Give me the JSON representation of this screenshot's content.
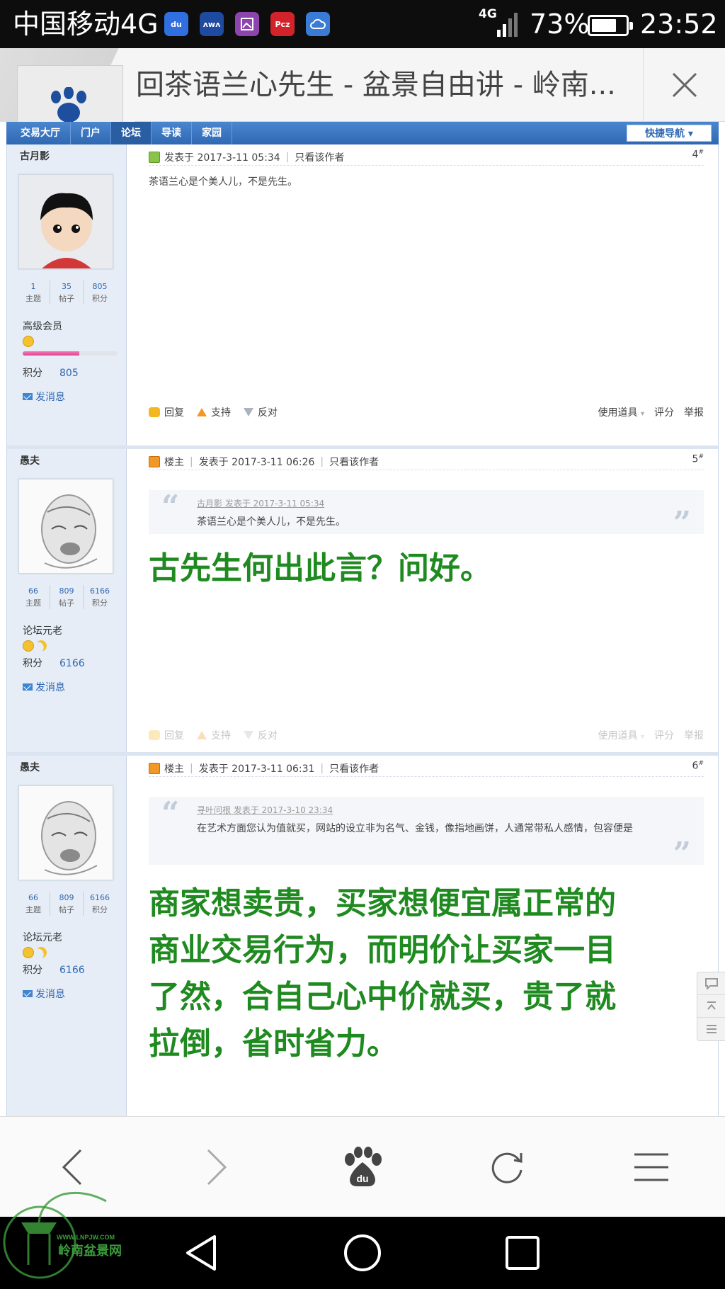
{
  "status_bar": {
    "carrier": "中国移动4G",
    "network": "4G",
    "battery": "73%",
    "battery_level": 0.73,
    "time": "23:52",
    "apps": [
      {
        "icon": "baidu-app-icon",
        "label": "du",
        "color": "#2f6fe0"
      },
      {
        "icon": "wifi-app-icon",
        "label": "ᴧᴡᴧ",
        "color": "#1e4aa0"
      },
      {
        "icon": "gallery-app-icon",
        "label": "",
        "color": "#8e44ad"
      },
      {
        "icon": "pcz-app-icon",
        "label": "Pcz",
        "color": "#d2232a"
      },
      {
        "icon": "cloud-app-icon",
        "label": "",
        "color": "#3a7bd5"
      }
    ]
  },
  "browser": {
    "tab_title": "回茶语兰心先生 - 盆景自由讲 - 岭南...",
    "close_icon": "close-icon"
  },
  "site_nav": {
    "items": [
      "交易大厅",
      "门户",
      "论坛",
      "导读",
      "家园"
    ],
    "active_index": 2,
    "quick_nav": "快捷导航"
  },
  "posts": [
    {
      "author": "古月影",
      "stats": [
        {
          "num": "1",
          "label": "主题"
        },
        {
          "num": "35",
          "label": "帖子"
        },
        {
          "num": "805",
          "label": "积分"
        }
      ],
      "rank": "高级会员",
      "rank_level": 0.6,
      "score_label": "积分",
      "score": "805",
      "send_msg": "发消息",
      "posted_at": "发表于 2017-3-11 05:34",
      "only_author": "只看该作者",
      "floor": "4",
      "floor_mark": "#",
      "text": "茶语兰心是个美人儿，不是先生。",
      "footer": {
        "reply": "回复",
        "support": "支持",
        "oppose": "反对",
        "tools": "使用道具",
        "rate": "评分",
        "report": "举报"
      }
    },
    {
      "author": "愚夫",
      "stats": [
        {
          "num": "66",
          "label": "主题"
        },
        {
          "num": "809",
          "label": "帖子"
        },
        {
          "num": "6166",
          "label": "积分"
        }
      ],
      "rank": "论坛元老",
      "score_label": "积分",
      "score": "6166",
      "send_msg": "发消息",
      "owner_label": "楼主",
      "posted_at": "发表于 2017-3-11 06:26",
      "only_author": "只看该作者",
      "floor": "5",
      "floor_mark": "#",
      "quote_source": "古月影 发表于 2017-3-11 05:34",
      "quote_text": "茶语兰心是个美人儿，不是先生。",
      "text": "古先生何出此言？问好。",
      "footer": {
        "reply": "回复",
        "support": "支持",
        "oppose": "反对",
        "tools": "使用道具",
        "rate": "评分",
        "report": "举报"
      }
    },
    {
      "author": "愚夫",
      "stats": [
        {
          "num": "66",
          "label": "主题"
        },
        {
          "num": "809",
          "label": "帖子"
        },
        {
          "num": "6166",
          "label": "积分"
        }
      ],
      "rank": "论坛元老",
      "score_label": "积分",
      "score": "6166",
      "send_msg": "发消息",
      "owner_label": "楼主",
      "posted_at": "发表于 2017-3-11 06:31",
      "only_author": "只看该作者",
      "floor": "6",
      "floor_mark": "#",
      "quote_source": "寻叶问根 发表于 2017-3-10 23:34",
      "quote_text": "在艺术方面您认为值就买，网站的设立非为名气、金钱，像指地画饼，人通常带私人感情，包容便是",
      "text_lines": [
        "商家想卖贵，买家想便宜属正常的",
        "商业交易行为，而明价让买家一目",
        "了然，合自己心中价就买，贵了就",
        "拉倒，省时省力。"
      ]
    }
  ],
  "watermark": {
    "url": "WWW.LNPJW.COM",
    "name": "岭南盆景网"
  },
  "browser_bar": [
    "back-icon",
    "forward-icon",
    "baidu-home-icon",
    "refresh-icon",
    "menu-icon"
  ],
  "android_nav": [
    "android-back-icon",
    "android-home-icon",
    "android-recents-icon"
  ]
}
